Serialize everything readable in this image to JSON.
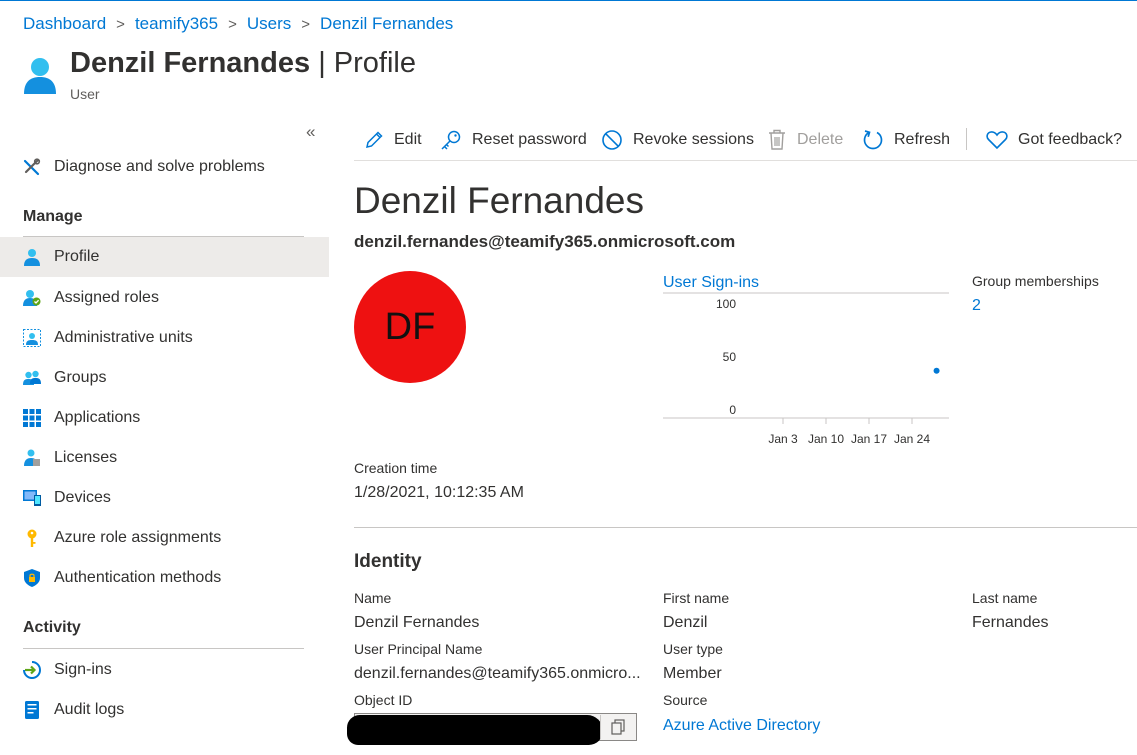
{
  "breadcrumb": {
    "items": [
      "Dashboard",
      "teamify365",
      "Users",
      "Denzil Fernandes"
    ],
    "separator": ">"
  },
  "header": {
    "name": "Denzil Fernandes",
    "pipe": "|",
    "blade": "Profile",
    "subtitle": "User",
    "icon": "user-icon"
  },
  "sidebar": {
    "collapse_glyph": "«",
    "diagnose": {
      "label": "Diagnose and solve problems",
      "icon": "wrench-icon"
    },
    "manage_heading": "Manage",
    "manage_items": [
      {
        "label": "Profile",
        "icon": "user-icon",
        "selected": true
      },
      {
        "label": "Assigned roles",
        "icon": "assigned-roles-icon"
      },
      {
        "label": "Administrative units",
        "icon": "admin-units-icon"
      },
      {
        "label": "Groups",
        "icon": "groups-icon"
      },
      {
        "label": "Applications",
        "icon": "applications-grid-icon"
      },
      {
        "label": "Licenses",
        "icon": "licenses-icon"
      },
      {
        "label": "Devices",
        "icon": "devices-icon"
      },
      {
        "label": "Azure role assignments",
        "icon": "key-icon"
      },
      {
        "label": "Authentication methods",
        "icon": "shield-icon"
      }
    ],
    "activity_heading": "Activity",
    "activity_items": [
      {
        "label": "Sign-ins",
        "icon": "sign-in-icon"
      },
      {
        "label": "Audit logs",
        "icon": "audit-log-icon"
      }
    ]
  },
  "toolbar": {
    "edit": "Edit",
    "reset_password": "Reset password",
    "revoke_sessions": "Revoke sessions",
    "delete": "Delete",
    "refresh": "Refresh",
    "feedback": "Got feedback?"
  },
  "profile": {
    "display_name": "Denzil Fernandes",
    "email": "denzil.fernandes@teamify365.onmicrosoft.com",
    "initials": "DF",
    "avatar_color": "#ee1111"
  },
  "signins": {
    "title": "User Sign-ins",
    "y_ticks": [
      "100",
      "50",
      "0"
    ],
    "x_ticks": [
      "Jan 3",
      "Jan 10",
      "Jan 17",
      "Jan 24"
    ]
  },
  "chart_data": {
    "type": "scatter",
    "title": "User Sign-ins",
    "ylim": [
      0,
      100
    ],
    "y_ticks": [
      100,
      50,
      0
    ],
    "x_ticks": [
      "Jan 3",
      "Jan 10",
      "Jan 17",
      "Jan 24"
    ],
    "series": [
      {
        "points": [
          {
            "x": "Jan 28",
            "y": 37
          }
        ]
      }
    ],
    "grid": false,
    "color": "#0078d4"
  },
  "groups": {
    "label": "Group memberships",
    "value": "2"
  },
  "creation": {
    "label": "Creation time",
    "value": "1/28/2021, 10:12:35 AM"
  },
  "identity": {
    "heading": "Identity",
    "name_label": "Name",
    "name_value": "Denzil Fernandes",
    "first_label": "First name",
    "first_value": "Denzil",
    "last_label": "Last name",
    "last_value": "Fernandes",
    "upn_label": "User Principal Name",
    "upn_value": "denzil.fernandes@teamify365.onmicro...",
    "type_label": "User type",
    "type_value": "Member",
    "objid_label": "Object ID",
    "source_label": "Source",
    "source_value": "Azure Active Directory"
  },
  "colors": {
    "accent": "#0078d4",
    "selected_bg": "#edebe9",
    "text": "#323130"
  }
}
